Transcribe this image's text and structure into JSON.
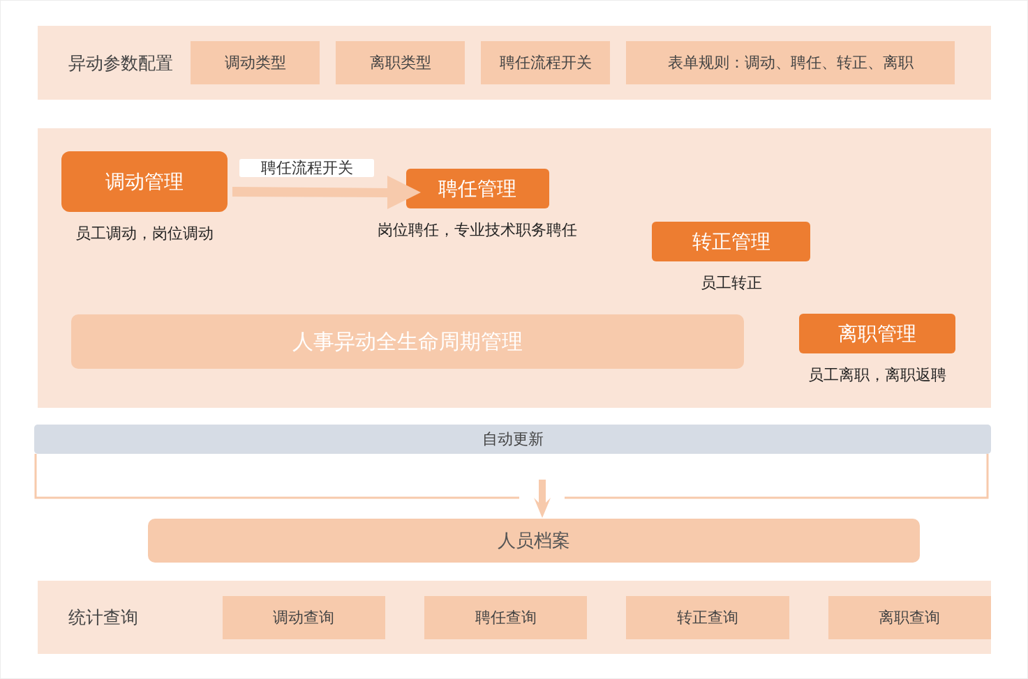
{
  "config": {
    "title": "异动参数配置",
    "items": [
      "调动类型",
      "离职类型",
      "聘任流程开关",
      "表单规则：调动、聘任、转正、离职"
    ]
  },
  "lifecycle": {
    "modules": [
      {
        "name": "调动管理",
        "description": "员工调动，岗位调动"
      },
      {
        "name": "聘任管理",
        "description": "岗位聘任，专业技术职务聘任"
      },
      {
        "name": "转正管理",
        "description": "员工转正"
      },
      {
        "name": "离职管理",
        "description": "员工离职，离职返聘"
      }
    ],
    "arrow_label": "聘任流程开关",
    "center_title": "人事异动全生命周期管理"
  },
  "update_bar": "自动更新",
  "archive": "人员档案",
  "query": {
    "title": "统计查询",
    "items": [
      "调动查询",
      "聘任查询",
      "转正查询",
      "离职查询"
    ]
  }
}
